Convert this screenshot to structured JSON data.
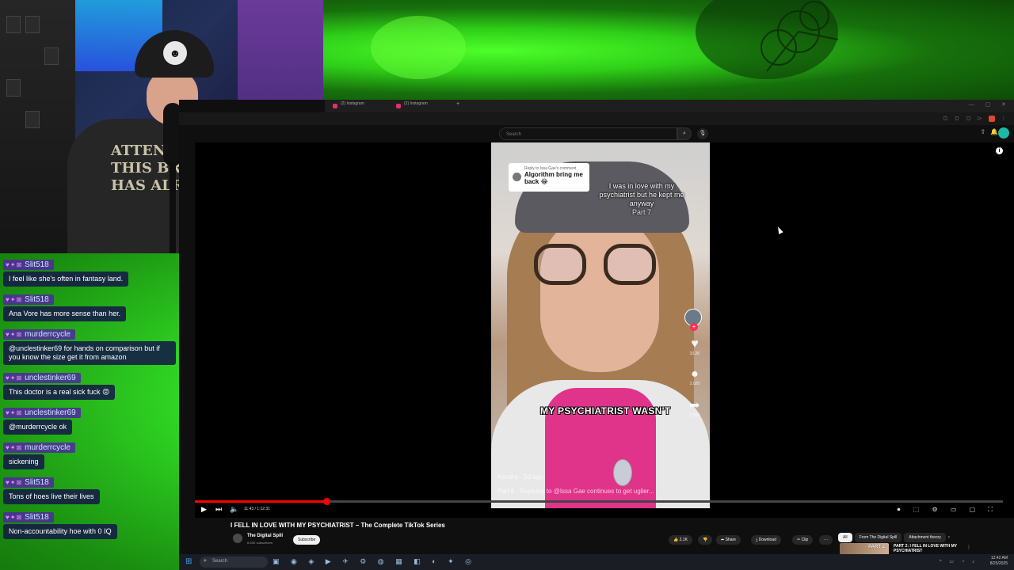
{
  "browser": {
    "tabs": [
      {
        "label": "(2) Instagram"
      },
      {
        "label": "(2) Instagram"
      }
    ],
    "new_tab": "+"
  },
  "youtube": {
    "search_placeholder": "Search",
    "video": {
      "title": "I FELL IN LOVE WITH MY PSYCHIATRIST – The Complete TikTok Series",
      "channel": "The Digital Spill",
      "subscribers": "6.63K subscribers",
      "subscribe_label": "Subscribe",
      "time": "11:43 / 1:12:31",
      "progress": 0.163,
      "likes": "2.1K",
      "share_label": "Share",
      "download_label": "Download",
      "clip_label": "Clip",
      "more_label": "···"
    },
    "chips": [
      {
        "label": "All",
        "active": true
      },
      {
        "label": "From The Digital Spill",
        "active": false
      },
      {
        "label": "Attachment theory",
        "active": false
      }
    ],
    "chips_next": "›",
    "recommendation": {
      "thumb_text": "PART 2:",
      "title": "PART 2: I FELL IN LOVE WITH MY PSYCHIATRIST"
    }
  },
  "tiktok": {
    "reply_sub": "Reply to Issa Gae's comment",
    "reply_main": "Algorithm bring me back 😂",
    "overlay_text": "I was in love with my psychiatrist but he kept me anyway",
    "overlay_part": "Part 7",
    "caption": "MY PSYCHIATRIST WASN'T",
    "likes": "33.2K",
    "comments": "2,020",
    "shares": "3,228",
    "username": "Kendra",
    "posted": "5d ago",
    "description": "Part 8 · Replying to @Issa Gae continues to get uglier..."
  },
  "chat": [
    {
      "user": "Slit518",
      "text": "I feel like she's often in fantasy land."
    },
    {
      "user": "Slit518",
      "text": "Ana Vore has more sense than her."
    },
    {
      "user": "murderrcycle",
      "text": "@unclestinker69 for hands on comparison but if you know the size get it from amazon"
    },
    {
      "user": "unclestinker69",
      "text": "This doctor is a real sick fuck 😡"
    },
    {
      "user": "unclestinker69",
      "text": "@murderrcycle ok"
    },
    {
      "user": "murderrcycle",
      "text": "sickening"
    },
    {
      "user": "Slit518",
      "text": "Tons of hoes live their lives"
    },
    {
      "user": "Slit518",
      "text": "Non-accountability hoe with 0 IQ"
    }
  ],
  "webcam": {
    "shirt_text_1": "ATTENTION",
    "shirt_text_2": "THIS BRAIN",
    "shirt_text_3": "HAS ALREADY"
  },
  "taskbar": {
    "search_placeholder": "Search",
    "time": "12:42 AM",
    "date": "8/25/2025"
  }
}
